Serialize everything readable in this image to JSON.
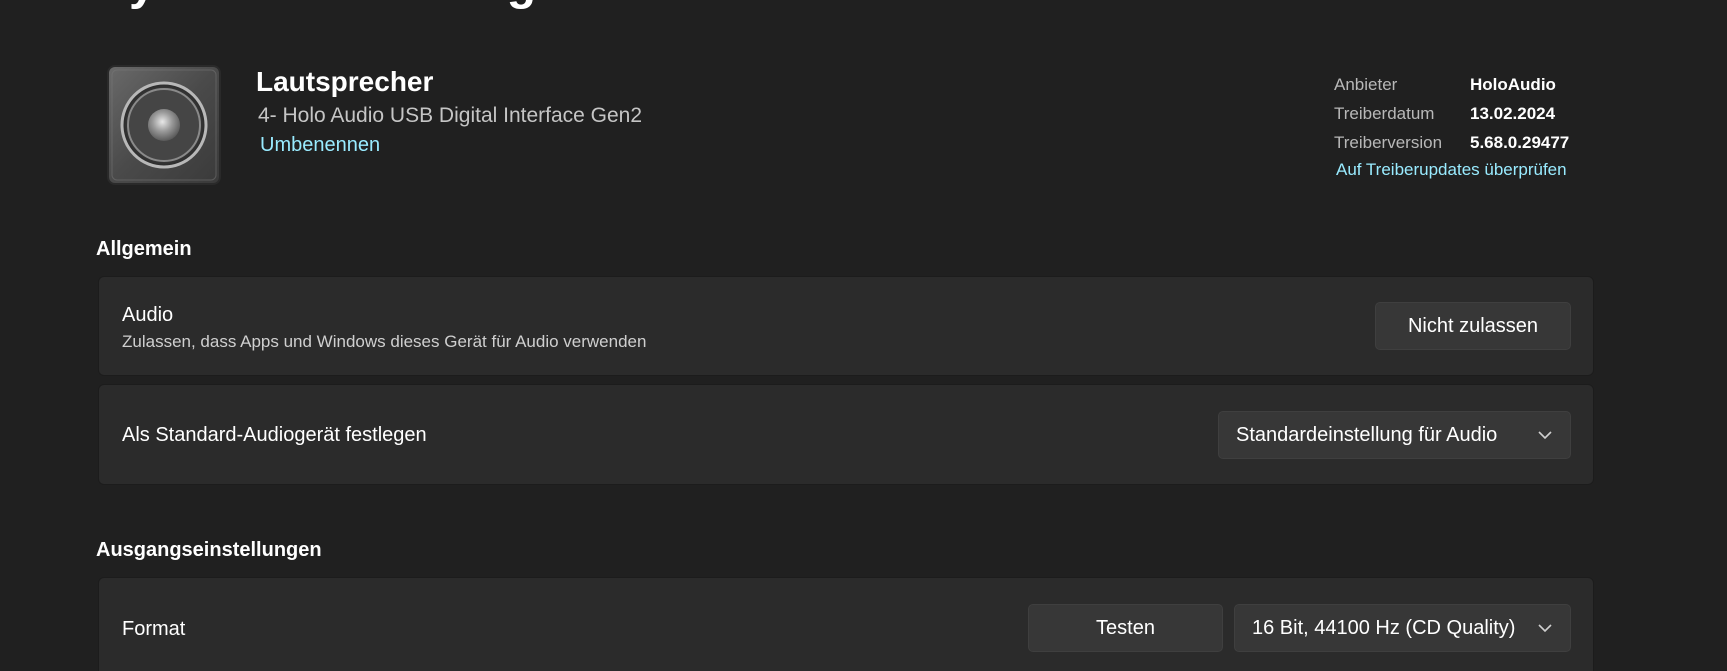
{
  "page": {
    "title_partial": "Systemeinstellungen"
  },
  "device": {
    "name": "Lautsprecher",
    "subtitle": "4- Holo Audio USB Digital Interface Gen2",
    "rename_label": "Umbenennen",
    "icon": "speaker-icon"
  },
  "driver": {
    "rows": [
      {
        "label": "Anbieter",
        "value": "HoloAudio"
      },
      {
        "label": "Treiberdatum",
        "value": "13.02.2024"
      },
      {
        "label": "Treiberversion",
        "value": "5.68.0.29477"
      }
    ],
    "update_link": "Auf Treiberupdates überprüfen"
  },
  "general": {
    "title": "Allgemein",
    "audio": {
      "title": "Audio",
      "description": "Zulassen, dass Apps und Windows dieses Gerät für Audio verwenden",
      "button_label": "Nicht zulassen"
    },
    "default_device": {
      "title": "Als Standard-Audiogerät festlegen",
      "dropdown_value": "Standardeinstellung für Audio"
    }
  },
  "output": {
    "title": "Ausgangseinstellungen",
    "format": {
      "title": "Format",
      "test_label": "Testen",
      "dropdown_value": "16 Bit, 44100 Hz (CD Quality)"
    }
  },
  "colors": {
    "background": "#202020",
    "card": "#2b2b2b",
    "button": "#373737",
    "accent_link": "#99ebff"
  }
}
